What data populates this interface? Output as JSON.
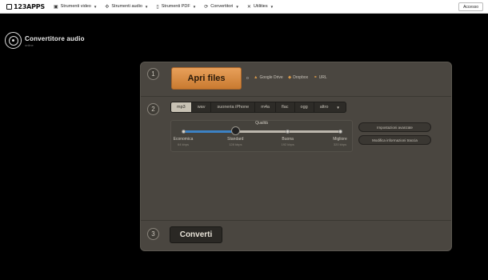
{
  "topbar": {
    "logo": "123APPS",
    "nav": [
      {
        "label": "Strumenti video",
        "icon": "video-icon"
      },
      {
        "label": "Strumenti audio",
        "icon": "audio-icon"
      },
      {
        "label": "Strumenti PDF",
        "icon": "pdf-icon"
      },
      {
        "label": "Convertitori",
        "icon": "convert-icon"
      },
      {
        "label": "Utilities",
        "icon": "tools-icon"
      }
    ],
    "login": "Accesso"
  },
  "app": {
    "title": "Convertitore audio",
    "subtitle": "online"
  },
  "step1": {
    "number": "1",
    "open_files": "Apri files",
    "or": "o",
    "sources": [
      {
        "label": "Google Drive",
        "icon": "google-drive-icon"
      },
      {
        "label": "Dropbox",
        "icon": "dropbox-icon"
      },
      {
        "label": "URL",
        "icon": "link-icon"
      }
    ]
  },
  "step2": {
    "number": "2",
    "formats": [
      "mp3",
      "wav",
      "suoneria iPhone",
      "m4a",
      "flac",
      "ogg",
      "altro"
    ],
    "selected_format": "mp3",
    "quality": {
      "title": "Qualità",
      "levels": [
        {
          "label": "Economica",
          "kbps": "64 kbps"
        },
        {
          "label": "Standard",
          "kbps": "128 kbps"
        },
        {
          "label": "Buona",
          "kbps": "192 kbps"
        },
        {
          "label": "Migliore",
          "kbps": "320 kbps"
        }
      ],
      "selected_index": 1
    },
    "advanced_settings": "Impostazioni avanzate",
    "edit_track_info": "Modifica informazioni traccia"
  },
  "step3": {
    "number": "3",
    "convert": "Converti"
  },
  "colors": {
    "accent_orange": "#d98a40",
    "slider_blue": "#3c82c4",
    "panel_bg": "#4a4640"
  }
}
